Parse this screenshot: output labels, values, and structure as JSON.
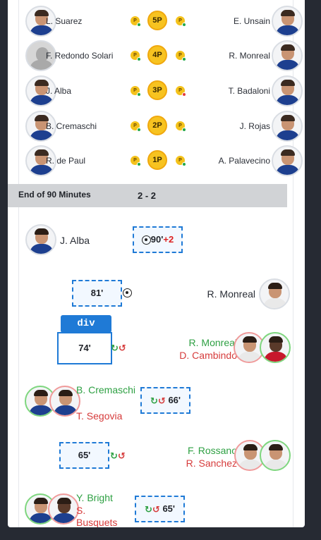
{
  "penalties": [
    {
      "left_player": "L. Suarez",
      "round": "5P",
      "right_player": "E. Unsain",
      "left_result": "scored",
      "right_result": "scored"
    },
    {
      "left_player": "F. Redondo Solari",
      "round": "4P",
      "right_player": "R. Monreal",
      "left_result": "scored",
      "right_result": "scored"
    },
    {
      "left_player": "J. Alba",
      "round": "3P",
      "right_player": "T. Badaloni",
      "left_result": "scored",
      "right_result": "missed"
    },
    {
      "left_player": "B. Cremaschi",
      "round": "2P",
      "right_player": "J. Rojas",
      "left_result": "scored",
      "right_result": "scored"
    },
    {
      "left_player": "R. de Paul",
      "round": "1P",
      "right_player": "A. Palavecino",
      "left_result": "scored",
      "right_result": "scored"
    }
  ],
  "penalty_ball_label": "P",
  "full_time": {
    "label": "End of 90 Minutes",
    "score": "2 - 2"
  },
  "events": {
    "e1": {
      "player": "J. Alba",
      "minute": "90'",
      "added": "+2",
      "type": "goal-icon"
    },
    "e2": {
      "minute": "81'",
      "player": "R. Monreal",
      "type": "goal-icon"
    },
    "e3": {
      "minute": "74'",
      "in": "R. Monreal",
      "out": "D. Cambindo",
      "type": "substitution-icon"
    },
    "e4": {
      "in": "B. Cremaschi",
      "out": "T. Segovia",
      "minute": "66'",
      "type": "substitution-icon"
    },
    "e5": {
      "minute": "65'",
      "in": "F. Rossano",
      "out": "R. Sanchez",
      "type": "substitution-icon"
    },
    "e6": {
      "in": "Y. Bright",
      "out": "S. Busquets",
      "minute": "65'",
      "type": "substitution-icon"
    }
  },
  "inspector_tag": "div",
  "colors": {
    "sub_in": "#2ea043",
    "sub_out": "#d63b3b",
    "penalty_ball": "#f7c320",
    "highlight": "#1f7ad6",
    "background": "#262a33"
  }
}
